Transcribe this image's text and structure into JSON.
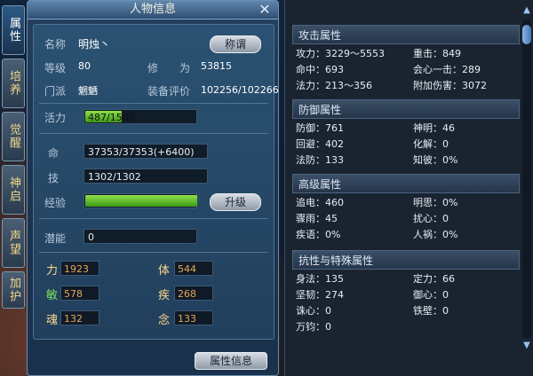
{
  "window": {
    "title": "人物信息",
    "bottom_button": "属性信息"
  },
  "side_tabs": [
    "属性",
    "培养",
    "觉醒",
    "神启",
    "声望",
    "加护"
  ],
  "profile": {
    "name_label": "名称",
    "name_value": "明烛丶",
    "rename_button": "称谓",
    "level_label": "等级",
    "level_value": "80",
    "cultivation_label": "修　　为",
    "cultivation_value": "53815",
    "sect_label": "门派",
    "sect_value": "魍魉",
    "equip_label": "装备评价",
    "equip_value": "102256/102266",
    "vitality_label": "活力",
    "vitality_value": "487/1500",
    "vitality_fraction": 0.3247,
    "life_label": "命",
    "life_value": "37353/37353(+6400)",
    "skill_label": "技",
    "skill_value": "1302/1302",
    "exp_label": "经验",
    "exp_fraction": 1.0,
    "upgrade_button": "升级",
    "potential_label": "潜能",
    "potential_value": "0"
  },
  "attributes": [
    {
      "name": "力",
      "value": "1923"
    },
    {
      "name": "体",
      "value": "544"
    },
    {
      "name": "敏",
      "value": "578"
    },
    {
      "name": "疾",
      "value": "268"
    },
    {
      "name": "魂",
      "value": "132"
    },
    {
      "name": "念",
      "value": "133"
    }
  ],
  "sections": [
    {
      "title": "攻击属性",
      "rows": [
        [
          "攻力：3229～5553",
          "重击：849"
        ],
        [
          "命中：693",
          "会心一击：289"
        ],
        [
          "法力：213～356",
          "附加伤害：3072"
        ]
      ]
    },
    {
      "title": "防御属性",
      "rows": [
        [
          "防御：761",
          "神明：46"
        ],
        [
          "回避：402",
          "化解：0"
        ],
        [
          "法防：133",
          "知彼：0%"
        ]
      ]
    },
    {
      "title": "高级属性",
      "rows": [
        [
          "追电：460",
          "明思：0%"
        ],
        [
          "骤雨：45",
          "扰心：0"
        ],
        [
          "疾语：0%",
          "人祸：0%"
        ]
      ]
    },
    {
      "title": "抗性与特殊属性",
      "rows": [
        [
          "身法：135",
          "定力：66"
        ],
        [
          "坚韧：274",
          "御心：0"
        ],
        [
          "诛心：0",
          "铁壁：0"
        ],
        [
          "万钧：0",
          ""
        ]
      ]
    }
  ],
  "colors": {
    "accent": "#6d8eb0",
    "attr_value": "#e8a456",
    "gold": "#ffd88a"
  },
  "icons": {
    "close": "close-icon",
    "scroll_up": "chevron-up-icon",
    "scroll_down": "chevron-down-icon"
  }
}
